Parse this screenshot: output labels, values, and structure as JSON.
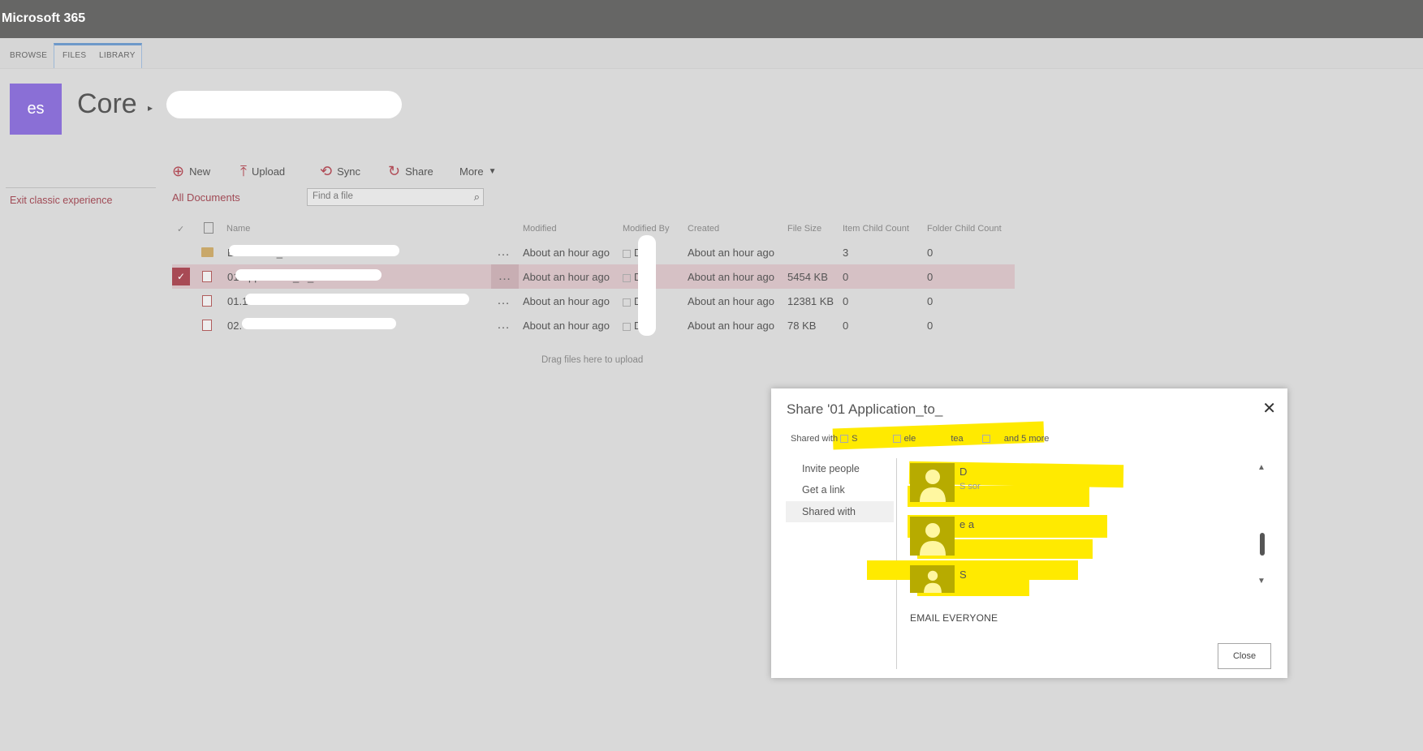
{
  "app": {
    "title": "Microsoft 365"
  },
  "ribbon": {
    "tabs": [
      "BROWSE",
      "FILES",
      "LIBRARY"
    ],
    "selected": "FILES"
  },
  "site": {
    "logo_text": "es",
    "title": "Core"
  },
  "left_nav": {
    "exit_label": "Exit classic experience"
  },
  "commands": {
    "new": "New",
    "upload": "Upload",
    "sync": "Sync",
    "share": "Share",
    "more": "More"
  },
  "view": {
    "title": "All Documents",
    "search_placeholder": "Find a file"
  },
  "table": {
    "headers": {
      "name": "Name",
      "modified": "Modified",
      "modified_by": "Modified By",
      "created": "Created",
      "file_size": "File Size",
      "item_child_count": "Item Child Count",
      "folder_child_count": "Folder Child Count"
    },
    "rows": [
      {
        "name": "Evaluation_",
        "modified": "About an hour ago",
        "modified_by": "D",
        "created": "About an hour ago",
        "file_size": "",
        "item_child_count": "3",
        "folder_child_count": "0",
        "type": "folder",
        "selected": false
      },
      {
        "name": "01 Application_to_",
        "modified": "About an hour ago",
        "modified_by": "DI",
        "created": "About an hour ago",
        "file_size": "5454 KB",
        "item_child_count": "0",
        "folder_child_count": "0",
        "type": "pdf",
        "selected": true
      },
      {
        "name": "01.1",
        "modified": "About an hour ago",
        "modified_by": "D",
        "created": "About an hour ago",
        "file_size": "12381 KB",
        "item_child_count": "0",
        "folder_child_count": "0",
        "type": "pdf",
        "selected": false
      },
      {
        "name": "02.",
        "modified": "About an hour ago",
        "modified_by": "DN",
        "created": "About an hour ago",
        "file_size": "78 KB",
        "item_child_count": "0",
        "folder_child_count": "0",
        "type": "pdf",
        "selected": false
      }
    ],
    "drag_hint": "Drag files here to upload"
  },
  "share_dialog": {
    "title": "Share '01 Application_to_",
    "shared_with_label": "Shared with",
    "shared_with_names": [
      "S",
      "ele",
      "tea"
    ],
    "and_more": "and 5 more",
    "nav": [
      "Invite people",
      "Get a link",
      "Shared with"
    ],
    "nav_selected": "Shared with",
    "people": [
      {
        "name": "D",
        "subtitle": "S          sor"
      },
      {
        "name": "e          a",
        "subtitle": ""
      },
      {
        "name": "S",
        "subtitle": ""
      }
    ],
    "email_everyone": "EMAIL EVERYONE",
    "close_label": "Close"
  },
  "colors": {
    "accent": "#a84a55",
    "topbar": "#666665",
    "logo": "#8a6fd6",
    "highlight": "#ffea00"
  }
}
